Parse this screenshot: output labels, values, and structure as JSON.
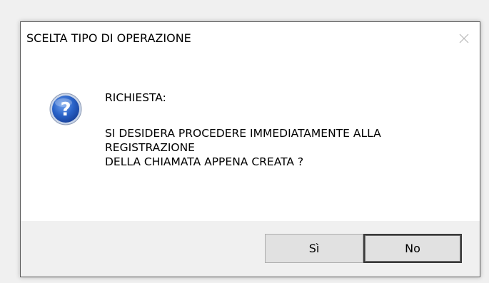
{
  "dialog": {
    "title": "SCELTA TIPO DI OPERAZIONE",
    "icon": "question-icon",
    "message_header": "RICHIESTA:",
    "message_lines": [
      "SI DESIDERA PROCEDERE IMMEDIATAMENTE ALLA",
      "REGISTRAZIONE",
      "DELLA CHIAMATA APPENA CREATA ?"
    ],
    "buttons": {
      "yes_label": "Sì",
      "no_label": "No"
    }
  },
  "colors": {
    "button_bar_bg": "#f0f0f0",
    "icon_blue": "#2a63c8"
  }
}
